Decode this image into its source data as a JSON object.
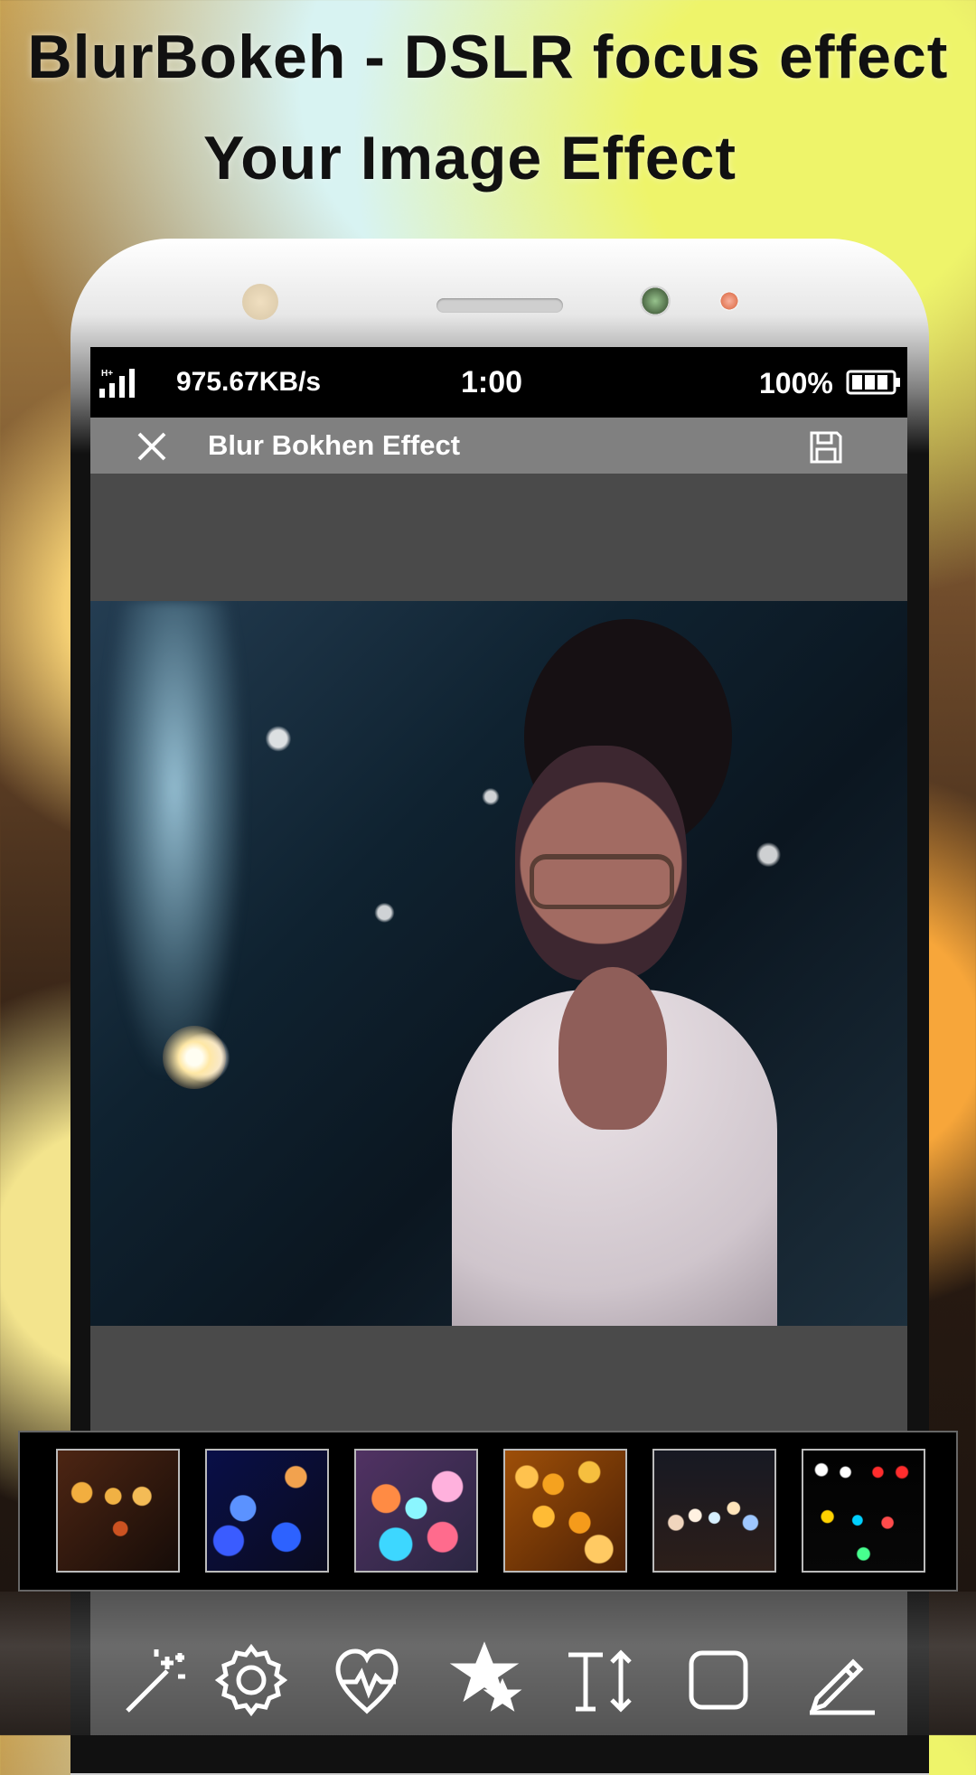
{
  "promo": {
    "title": "BlurBokeh - DSLR focus effect",
    "subtitle": "Your Image Effect"
  },
  "status_bar": {
    "speed": "975.67KB/s",
    "time": "1:00",
    "battery": "100%"
  },
  "app_bar": {
    "title": "Blur Bokhen Effect"
  },
  "effects": [
    {
      "name": "warm-orange-bokeh"
    },
    {
      "name": "blue-bokeh"
    },
    {
      "name": "multicolor-bokeh"
    },
    {
      "name": "gold-bokeh"
    },
    {
      "name": "city-lights-bokeh"
    },
    {
      "name": "rainbow-bokeh"
    }
  ],
  "toolbar": [
    {
      "icon": "magic-wand-icon"
    },
    {
      "icon": "gear-icon"
    },
    {
      "icon": "heartbeat-icon"
    },
    {
      "icon": "stars-icon"
    },
    {
      "icon": "text-size-icon"
    },
    {
      "icon": "square-icon"
    },
    {
      "icon": "pencil-icon"
    }
  ]
}
